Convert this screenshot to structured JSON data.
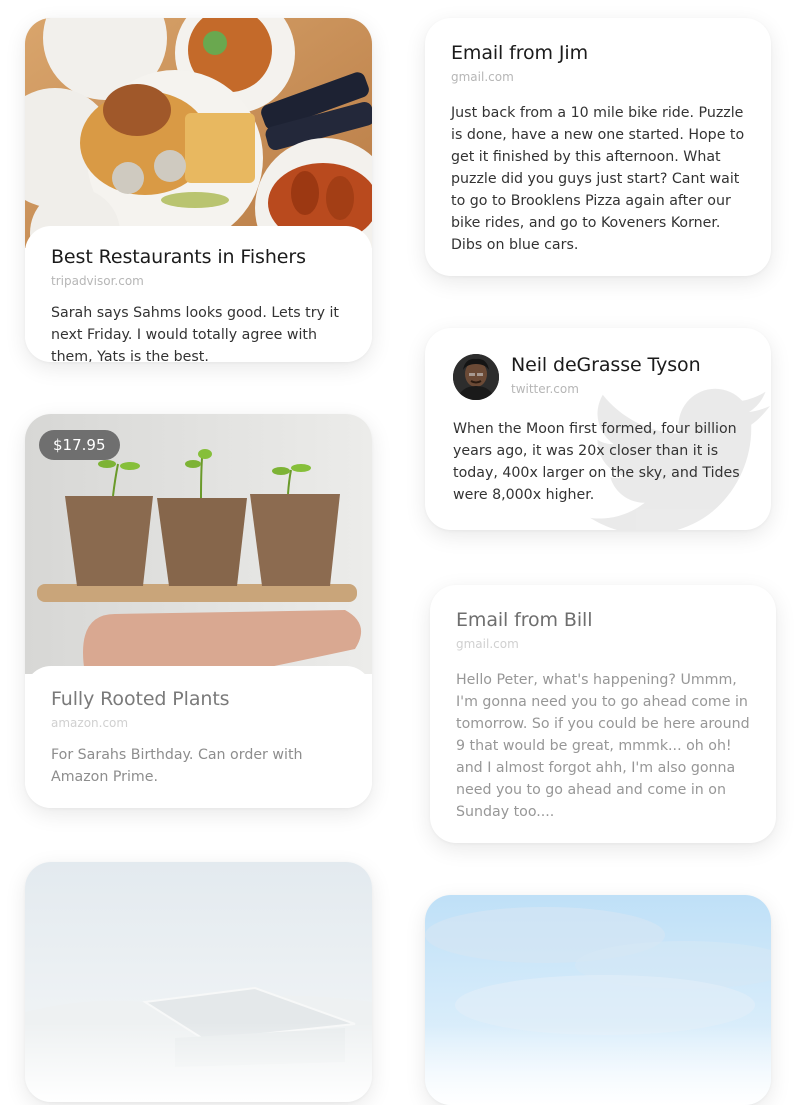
{
  "cards": {
    "restaurants": {
      "title": "Best Restaurants in Fishers",
      "source": "tripadvisor.com",
      "note": "Sarah says Sahms looks good. Lets try it next Friday. I would totally agree with them, Yats is the best."
    },
    "email_jim": {
      "title": "Email from Jim",
      "source": "gmail.com",
      "body": "Just back from a 10 mile bike ride. Puzzle is done, have a new one started. Hope to get it finished by this afternoon. What puzzle did you guys just start? Cant wait to go to Brooklens Pizza again after our bike rides, and go to Koveners Korner. Dibs on blue cars."
    },
    "tweet": {
      "author": "Neil deGrasse Tyson",
      "source": "twitter.com",
      "body": "When the Moon first formed, four billion years ago, it was 20x closer than it is today, 400x larger on the sky, and Tides were 8,000x higher.",
      "icon": "twitter-bird-icon"
    },
    "plants": {
      "price": "$17.95",
      "title": "Fully Rooted Plants",
      "source": "amazon.com",
      "note": "For Sarahs Birthday. Can order with Amazon Prime."
    },
    "email_bill": {
      "title": "Email from Bill",
      "source": "gmail.com",
      "body": "Hello Peter, what's happening? Ummm, I'm gonna need you to go ahead come in tomorrow. So if you could be here around 9 that would be great, mmmk... oh oh! and I almost forgot ahh, I'm also gonna need you to go ahead and come in on Sunday too...."
    }
  },
  "colors": {
    "card_bg": "#ffffff",
    "price_badge": "#6f6f6f",
    "source_text": "#b6b6b6"
  }
}
